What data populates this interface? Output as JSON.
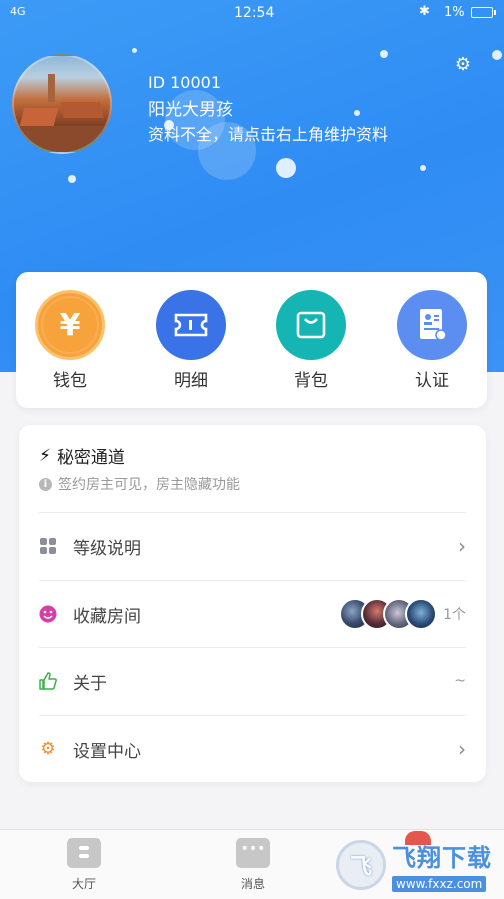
{
  "statusbar": {
    "signal": "4G",
    "time": "12:54",
    "battery": "1%"
  },
  "profile": {
    "id_line": "ID 10001",
    "name": "阳光大男孩",
    "hint": "资料不全，请点击右上角维护资料"
  },
  "quick_actions": [
    {
      "label": "钱包",
      "icon": "yen-coin-icon"
    },
    {
      "label": "明细",
      "icon": "ticket-icon"
    },
    {
      "label": "背包",
      "icon": "bag-icon"
    },
    {
      "label": "认证",
      "icon": "id-card-icon"
    }
  ],
  "secret": {
    "title": "秘密通道",
    "subtitle": "签约房主可见，房主隐藏功能"
  },
  "menu": {
    "level": {
      "label": "等级说明"
    },
    "favorites": {
      "label": "收藏房间",
      "count": "1个"
    },
    "about": {
      "label": "关于",
      "value": "~"
    },
    "settings": {
      "label": "设置中心"
    }
  },
  "tabs": [
    {
      "label": "大厅"
    },
    {
      "label": "消息"
    }
  ],
  "watermark": {
    "logo_text": "飞",
    "main": "飞翔下载",
    "url": "www.fxxz.com"
  },
  "colors": {
    "header_blue": "#3d9bf6",
    "wallet_orange": "#f8a23b",
    "detail_blue": "#3a73e8",
    "bag_teal": "#14b5b2",
    "auth_blue": "#5b8ef0"
  }
}
